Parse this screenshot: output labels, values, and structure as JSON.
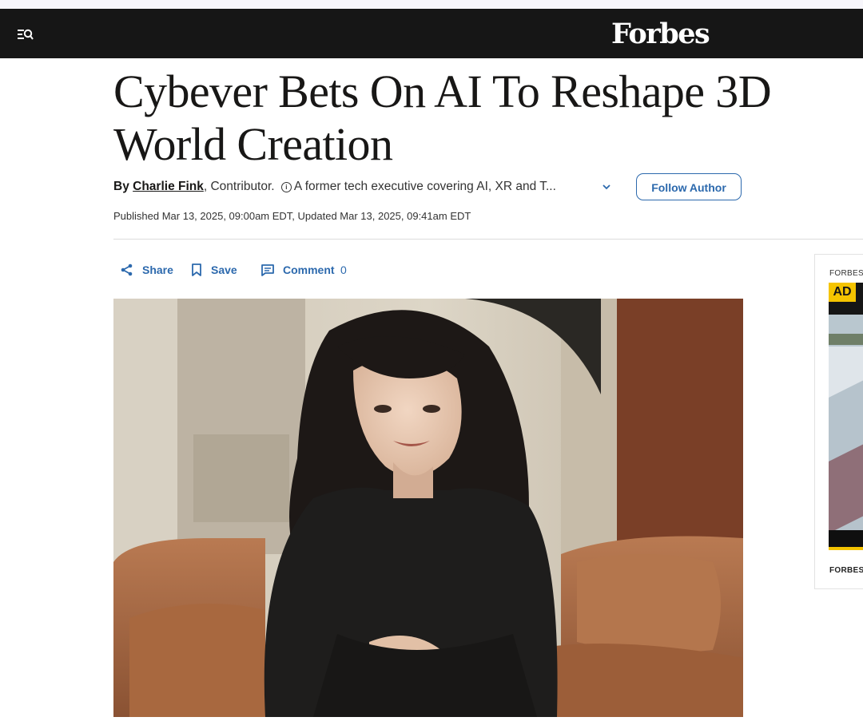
{
  "header": {
    "logo": "Forbes",
    "menu_icon": "menu-search-icon"
  },
  "article": {
    "title": "Cybever Bets On AI To Reshape 3D World Creation",
    "byline_prefix": "By",
    "author": "Charlie Fink",
    "author_role": ", Contributor.",
    "author_bio": "A former tech executive covering AI, XR and T...",
    "follow_label": "Follow Author",
    "published": "Published Mar 13, 2025, 09:00am EDT, Updated Mar 13, 2025, 09:41am EDT"
  },
  "actions": {
    "share_label": "Share",
    "save_label": "Save",
    "comment_label": "Comment",
    "comment_count": "0"
  },
  "sidebar": {
    "top_label": "FORBES",
    "ad_badge": "AD",
    "bottom_label": "FORBES"
  },
  "colors": {
    "navbar": "#161616",
    "link_blue": "#2c69ad",
    "ad_yellow": "#f5c400"
  }
}
